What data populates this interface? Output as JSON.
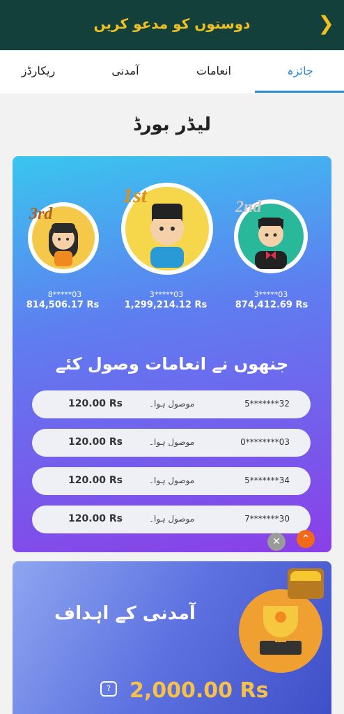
{
  "header": {
    "title": "دوستوں کو مدعو کریں",
    "back_icon": "chevron-right-icon"
  },
  "tabs": [
    {
      "label": "جائزہ",
      "active": true
    },
    {
      "label": "انعامات",
      "active": false
    },
    {
      "label": "آمدنی",
      "active": false
    },
    {
      "label": "ریکارڈز",
      "active": false
    }
  ],
  "leaderboard": {
    "title": "لیڈر بورڈ",
    "first": {
      "rank": "1st",
      "user": "3*****03",
      "amount": "1,299,214.12 Rs"
    },
    "second": {
      "rank": "2nd",
      "user": "3*****03",
      "amount": "874,412.69 Rs"
    },
    "third": {
      "rank": "3rd",
      "user": "8*****03",
      "amount": "814,506.17 Rs"
    }
  },
  "winners": {
    "title": "جنھوں نے انعامات وصول کئے",
    "rows": [
      {
        "phone": "5*******32",
        "status": "موصول ہوا۔",
        "amount": "120.00 Rs"
      },
      {
        "phone": "0********03",
        "status": "موصول ہوا۔",
        "amount": "120.00 Rs"
      },
      {
        "phone": "5*******34",
        "status": "موصول ہوا۔",
        "amount": "120.00 Rs"
      },
      {
        "phone": "7*******30",
        "status": "موصول ہوا۔",
        "amount": "120.00 Rs"
      }
    ]
  },
  "goals": {
    "title": "آمدنی کے اہداف",
    "amount": "2,000.00 Rs"
  },
  "colors": {
    "header_bg": "#14403c",
    "accent_gold": "#f0c020",
    "tab_active": "#2a8cd6"
  }
}
